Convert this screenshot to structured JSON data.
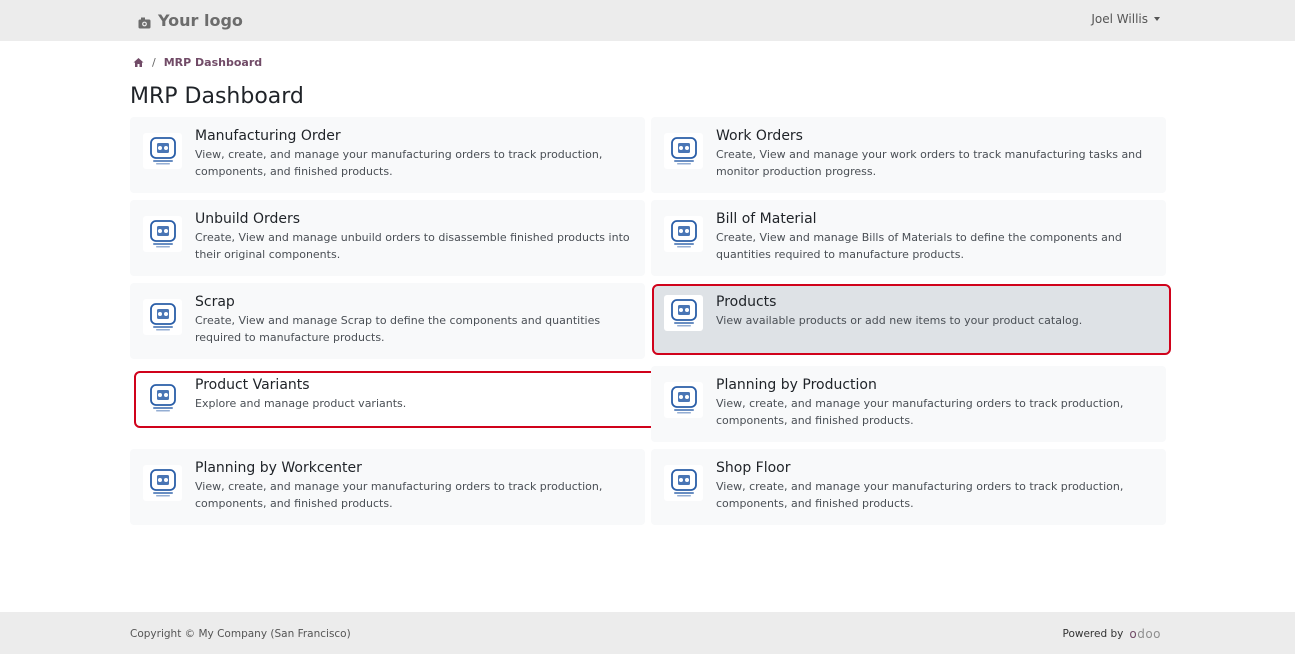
{
  "header": {
    "logo_text": "Your logo",
    "user_name": "Joel Willis"
  },
  "breadcrumb": {
    "current": "MRP Dashboard"
  },
  "page": {
    "title": "MRP Dashboard"
  },
  "cards": [
    {
      "title": "Manufacturing Order",
      "desc": "View, create, and manage your manufacturing orders to track production, components, and finished products.",
      "icon": "manufacturing-order-icon",
      "icon_caption": "Manufacturing Order"
    },
    {
      "title": "Work Orders",
      "desc": "Create, View and manage your work orders to track manufacturing tasks and monitor production progress.",
      "icon": "work-orders-icon",
      "icon_caption": "Work Order"
    },
    {
      "title": "Unbuild Orders",
      "desc": "Create, View and manage unbuild orders to disassemble finished products into their original components.",
      "icon": "unbuild-orders-icon",
      "icon_caption": "Unbuild Order"
    },
    {
      "title": "Bill of Material",
      "desc": "Create, View and manage Bills of Materials to define the components and quantities required to manufacture products.",
      "icon": "bom-icon",
      "icon_caption": "BOM"
    },
    {
      "title": "Scrap",
      "desc": "Create, View and manage Scrap to define the components and quantities required to manufacture products.",
      "icon": "scrap-icon",
      "icon_caption": "Scrap"
    },
    {
      "title": "Products",
      "desc": "View available products or add new items to your product catalog.",
      "icon": "product-icon",
      "icon_caption": "Product"
    },
    {
      "title": "Product Variants",
      "desc": "Explore and manage product variants.",
      "icon": "product-variants-icon",
      "icon_caption": "Product Variants"
    },
    {
      "title": "Planning by Production",
      "desc": "View, create, and manage your manufacturing orders to track production, components, and finished products.",
      "icon": "planning-production-icon",
      "icon_caption": "Planning by Production"
    },
    {
      "title": "Planning by Workcenter",
      "desc": "View, create, and manage your manufacturing orders to track production, components, and finished products.",
      "icon": "planning-workcenter-icon",
      "icon_caption": "Planning by Workcenter"
    },
    {
      "title": "Shop Floor",
      "desc": "View, create, and manage your manufacturing orders to track production, components, and finished products.",
      "icon": "shop-floor-icon",
      "icon_caption": "Shop Floor"
    }
  ],
  "footer": {
    "copyright": "Copyright © My Company (San Francisco)",
    "powered_by": "Powered by",
    "brand": "odoo"
  },
  "colors": {
    "brand": "#714b67",
    "icon_blue": "#2a5ea8",
    "highlight_outline": "#d0021b"
  }
}
